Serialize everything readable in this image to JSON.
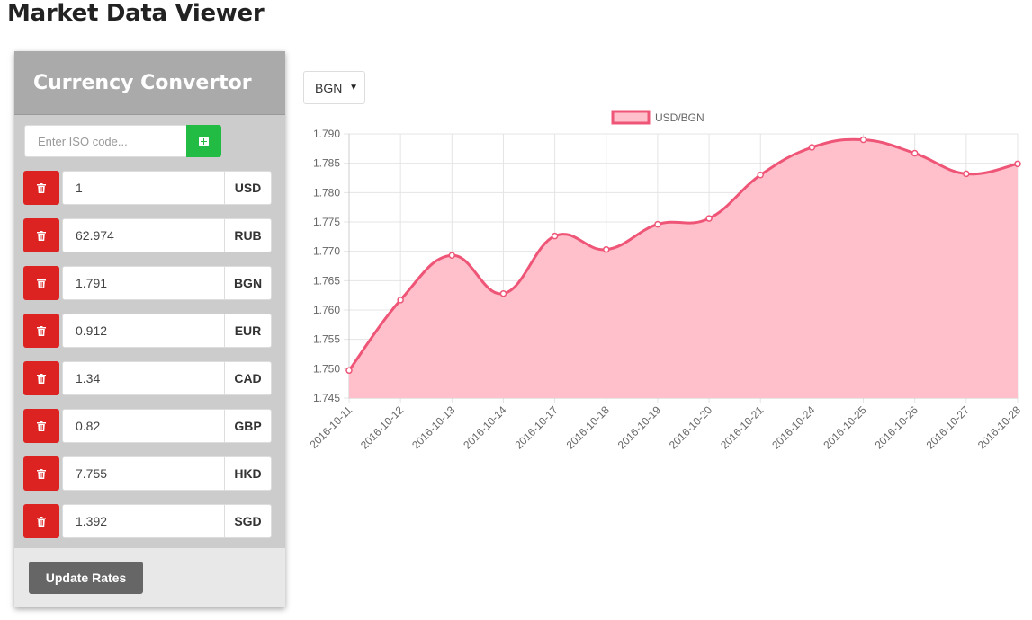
{
  "app": {
    "title": "Market Data Viewer"
  },
  "converter": {
    "title": "Currency Convertor",
    "iso_placeholder": "Enter ISO code...",
    "add_icon": "plus-square-icon",
    "delete_icon": "trash-icon",
    "rows": [
      {
        "amount": "1",
        "code": "USD"
      },
      {
        "amount": "62.974",
        "code": "RUB"
      },
      {
        "amount": "1.791",
        "code": "BGN"
      },
      {
        "amount": "0.912",
        "code": "EUR"
      },
      {
        "amount": "1.34",
        "code": "CAD"
      },
      {
        "amount": "0.82",
        "code": "GBP"
      },
      {
        "amount": "7.755",
        "code": "HKD"
      },
      {
        "amount": "1.392",
        "code": "SGD"
      }
    ],
    "update_label": "Update Rates",
    "colors": {
      "delete": "#dd2222",
      "add": "#22bb44",
      "update": "#666666"
    }
  },
  "chart_select": {
    "value": "BGN"
  },
  "chart_data": {
    "type": "area",
    "series": [
      {
        "name": "USD/BGN",
        "border_color": "#ee5577",
        "fill_color": "#ffc0cb",
        "values": [
          1.7497,
          1.7617,
          1.7693,
          1.7628,
          1.7726,
          1.7703,
          1.7746,
          1.7756,
          1.783,
          1.7877,
          1.789,
          1.7867,
          1.7832,
          1.7849
        ]
      }
    ],
    "x": [
      "2016-10-11",
      "2016-10-12",
      "2016-10-13",
      "2016-10-14",
      "2016-10-17",
      "2016-10-18",
      "2016-10-19",
      "2016-10-20",
      "2016-10-21",
      "2016-10-24",
      "2016-10-25",
      "2016-10-26",
      "2016-10-27",
      "2016-10-28"
    ],
    "y_ticks": [
      "1.790",
      "1.785",
      "1.780",
      "1.775",
      "1.770",
      "1.765",
      "1.760",
      "1.755",
      "1.750",
      "1.745"
    ],
    "ylim": [
      1.745,
      1.79
    ],
    "legend": "top",
    "grid": true
  }
}
